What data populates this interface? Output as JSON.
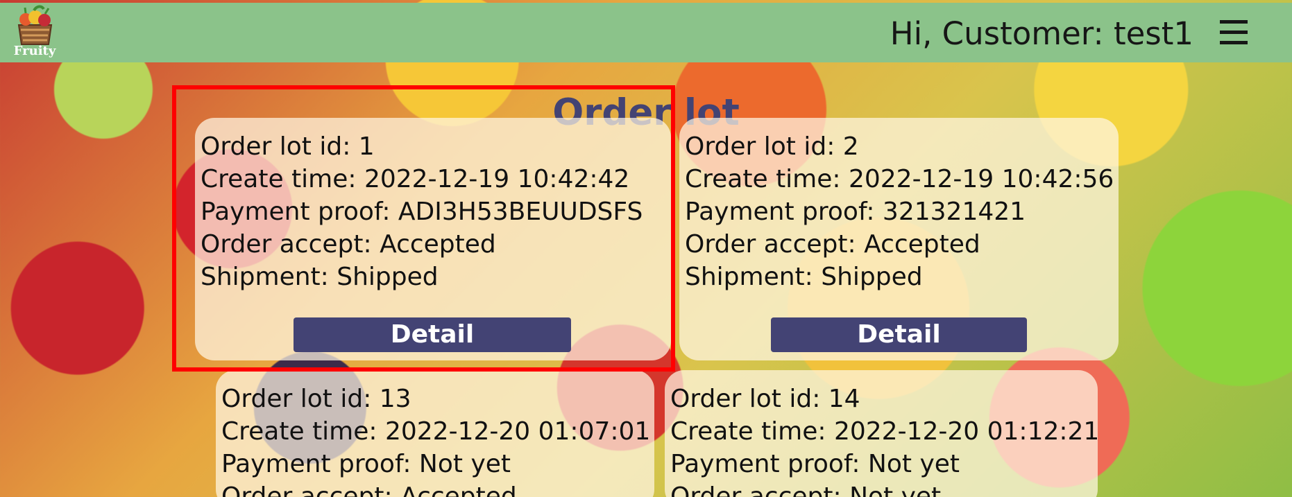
{
  "header": {
    "logo_text": "Fruity",
    "greeting": "Hi, Customer: test1",
    "menu_icon": "hamburger-menu-icon"
  },
  "page": {
    "title": "Order lot"
  },
  "orders": [
    {
      "lot_id": "Order lot id: 1",
      "create_time": "Create time: 2022-12-19 10:42:42",
      "payment_proof": "Payment proof: ADI3H53BEUUDSFS",
      "order_accept": "Order accept: Accepted",
      "shipment": "Shipment: Shipped",
      "detail_label": "Detail"
    },
    {
      "lot_id": "Order lot id: 2",
      "create_time": "Create time: 2022-12-19 10:42:56",
      "payment_proof": "Payment proof: 321321421",
      "order_accept": "Order accept: Accepted",
      "shipment": "Shipment: Shipped",
      "detail_label": "Detail"
    },
    {
      "lot_id": "Order lot id: 13",
      "create_time": "Create time: 2022-12-20 01:07:01",
      "payment_proof": "Payment proof: Not yet",
      "order_accept": "Order accept: Accepted"
    },
    {
      "lot_id": "Order lot id: 14",
      "create_time": "Create time: 2022-12-20 01:12:21",
      "payment_proof": "Payment proof: Not yet",
      "order_accept": "Order accept: Not yet"
    }
  ],
  "colors": {
    "header_bg": "#8bc38a",
    "title": "#434373",
    "button": "#434374",
    "highlight": "#ff0000"
  }
}
